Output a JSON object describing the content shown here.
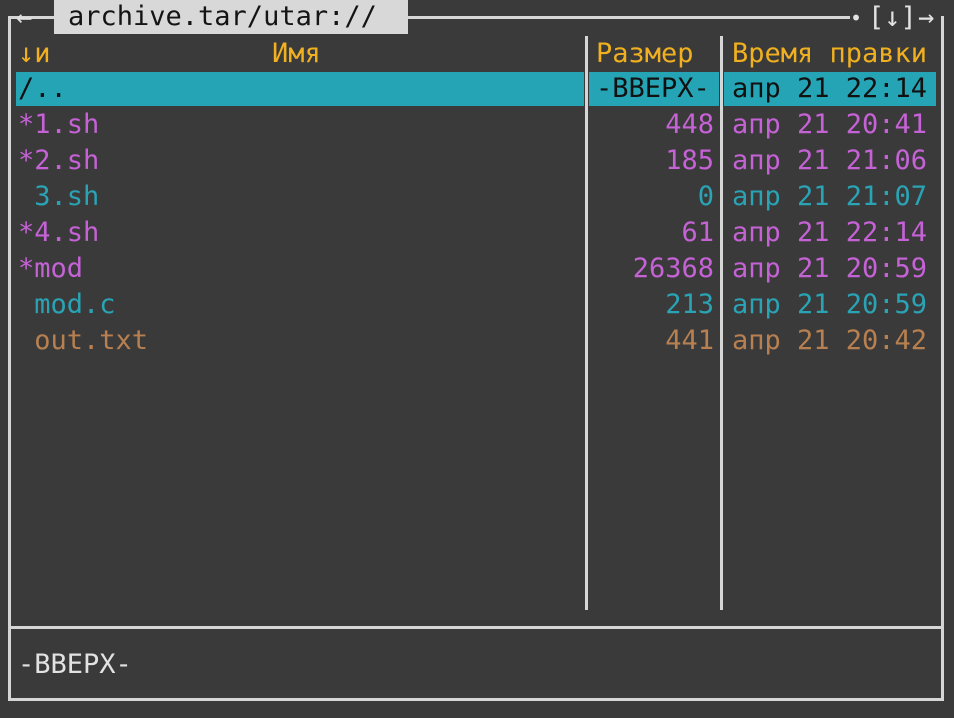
{
  "panel": {
    "title": "archive.tar/utar://",
    "nav_left": "←",
    "nav_right": "→",
    "dot": "•",
    "history": "[↓]"
  },
  "columns": {
    "sort": "↓и",
    "name": "Имя",
    "size": "Размер",
    "mtime": "Время правки"
  },
  "selected": {
    "name": "/..",
    "size": "-ВВЕРХ-",
    "mtime": "апр 21 22:14"
  },
  "files": [
    {
      "name": "*1.sh",
      "size": "448",
      "mtime": "апр 21 20:41",
      "color": "#c562d6"
    },
    {
      "name": "*2.sh",
      "size": "185",
      "mtime": "апр 21 21:06",
      "color": "#c562d6"
    },
    {
      "name": " 3.sh",
      "size": "0",
      "mtime": "апр 21 21:07",
      "color": "#2aa3b5"
    },
    {
      "name": "*4.sh",
      "size": "61",
      "mtime": "апр 21 22:14",
      "color": "#c562d6"
    },
    {
      "name": "*mod",
      "size": "26368",
      "mtime": "апр 21 20:59",
      "color": "#c562d6"
    },
    {
      "name": " mod.c",
      "size": "213",
      "mtime": "апр 21 20:59",
      "color": "#2aa3b5"
    },
    {
      "name": " out.txt",
      "size": "441",
      "mtime": "апр 21 20:42",
      "color": "#b88050"
    }
  ],
  "status": {
    "text": "-ВВЕРХ-"
  },
  "colors": {
    "background": "#3a3a3a",
    "frame": "#d6d6d6",
    "header": "#f0b020",
    "selection": "#25a4b5",
    "executable": "#c562d6",
    "source": "#2aa3b5",
    "text_file": "#b88050"
  }
}
